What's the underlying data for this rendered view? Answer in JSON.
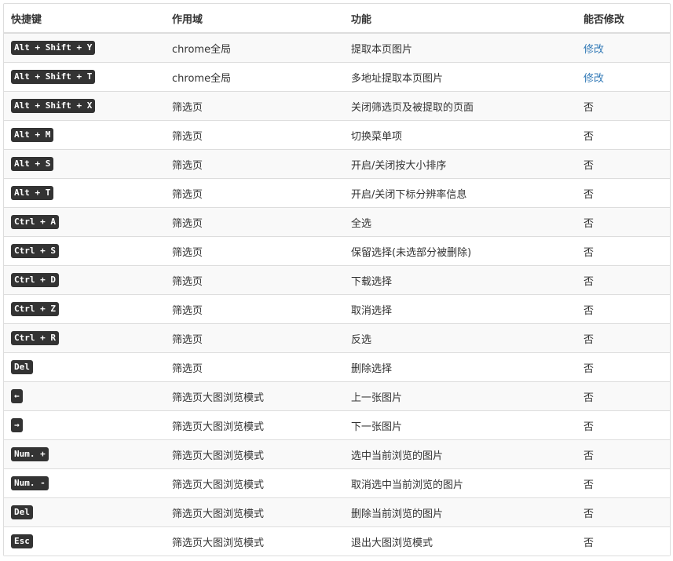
{
  "table": {
    "headers": [
      "快捷键",
      "作用域",
      "功能",
      "能否修改"
    ],
    "rows": [
      {
        "key": "Alt + Shift + Y",
        "scope": "chrome全局",
        "func": "提取本页图片",
        "editable": "修改",
        "is_link": true
      },
      {
        "key": "Alt + Shift + T",
        "scope": "chrome全局",
        "func": "多地址提取本页图片",
        "editable": "修改",
        "is_link": true
      },
      {
        "key": "Alt + Shift + X",
        "scope": "筛选页",
        "func": "关闭筛选页及被提取的页面",
        "editable": "否",
        "is_link": false
      },
      {
        "key": "Alt + M",
        "scope": "筛选页",
        "func": "切换菜单项",
        "editable": "否",
        "is_link": false
      },
      {
        "key": "Alt + S",
        "scope": "筛选页",
        "func": "开启/关闭按大小排序",
        "editable": "否",
        "is_link": false
      },
      {
        "key": "Alt + T",
        "scope": "筛选页",
        "func": "开启/关闭下标分辨率信息",
        "editable": "否",
        "is_link": false
      },
      {
        "key": "Ctrl + A",
        "scope": "筛选页",
        "func": "全选",
        "editable": "否",
        "is_link": false
      },
      {
        "key": "Ctrl + S",
        "scope": "筛选页",
        "func": "保留选择(未选部分被删除)",
        "editable": "否",
        "is_link": false
      },
      {
        "key": "Ctrl + D",
        "scope": "筛选页",
        "func": "下载选择",
        "editable": "否",
        "is_link": false
      },
      {
        "key": "Ctrl + Z",
        "scope": "筛选页",
        "func": "取消选择",
        "editable": "否",
        "is_link": false
      },
      {
        "key": "Ctrl + R",
        "scope": "筛选页",
        "func": "反选",
        "editable": "否",
        "is_link": false
      },
      {
        "key": "Del",
        "scope": "筛选页",
        "func": "删除选择",
        "editable": "否",
        "is_link": false
      },
      {
        "key": "←",
        "scope": "筛选页大图浏览模式",
        "func": "上一张图片",
        "editable": "否",
        "is_link": false
      },
      {
        "key": "→",
        "scope": "筛选页大图浏览模式",
        "func": "下一张图片",
        "editable": "否",
        "is_link": false
      },
      {
        "key": "Num. +",
        "scope": "筛选页大图浏览模式",
        "func": "选中当前浏览的图片",
        "editable": "否",
        "is_link": false
      },
      {
        "key": "Num. -",
        "scope": "筛选页大图浏览模式",
        "func": "取消选中当前浏览的图片",
        "editable": "否",
        "is_link": false
      },
      {
        "key": "Del",
        "scope": "筛选页大图浏览模式",
        "func": "删除当前浏览的图片",
        "editable": "否",
        "is_link": false
      },
      {
        "key": "Esc",
        "scope": "筛选页大图浏览模式",
        "func": "退出大图浏览模式",
        "editable": "否",
        "is_link": false
      }
    ]
  },
  "colors": {
    "link": "#337ab7",
    "kbd_bg": "#333333",
    "stripe": "#f9f9f9",
    "border": "#dddddd"
  }
}
